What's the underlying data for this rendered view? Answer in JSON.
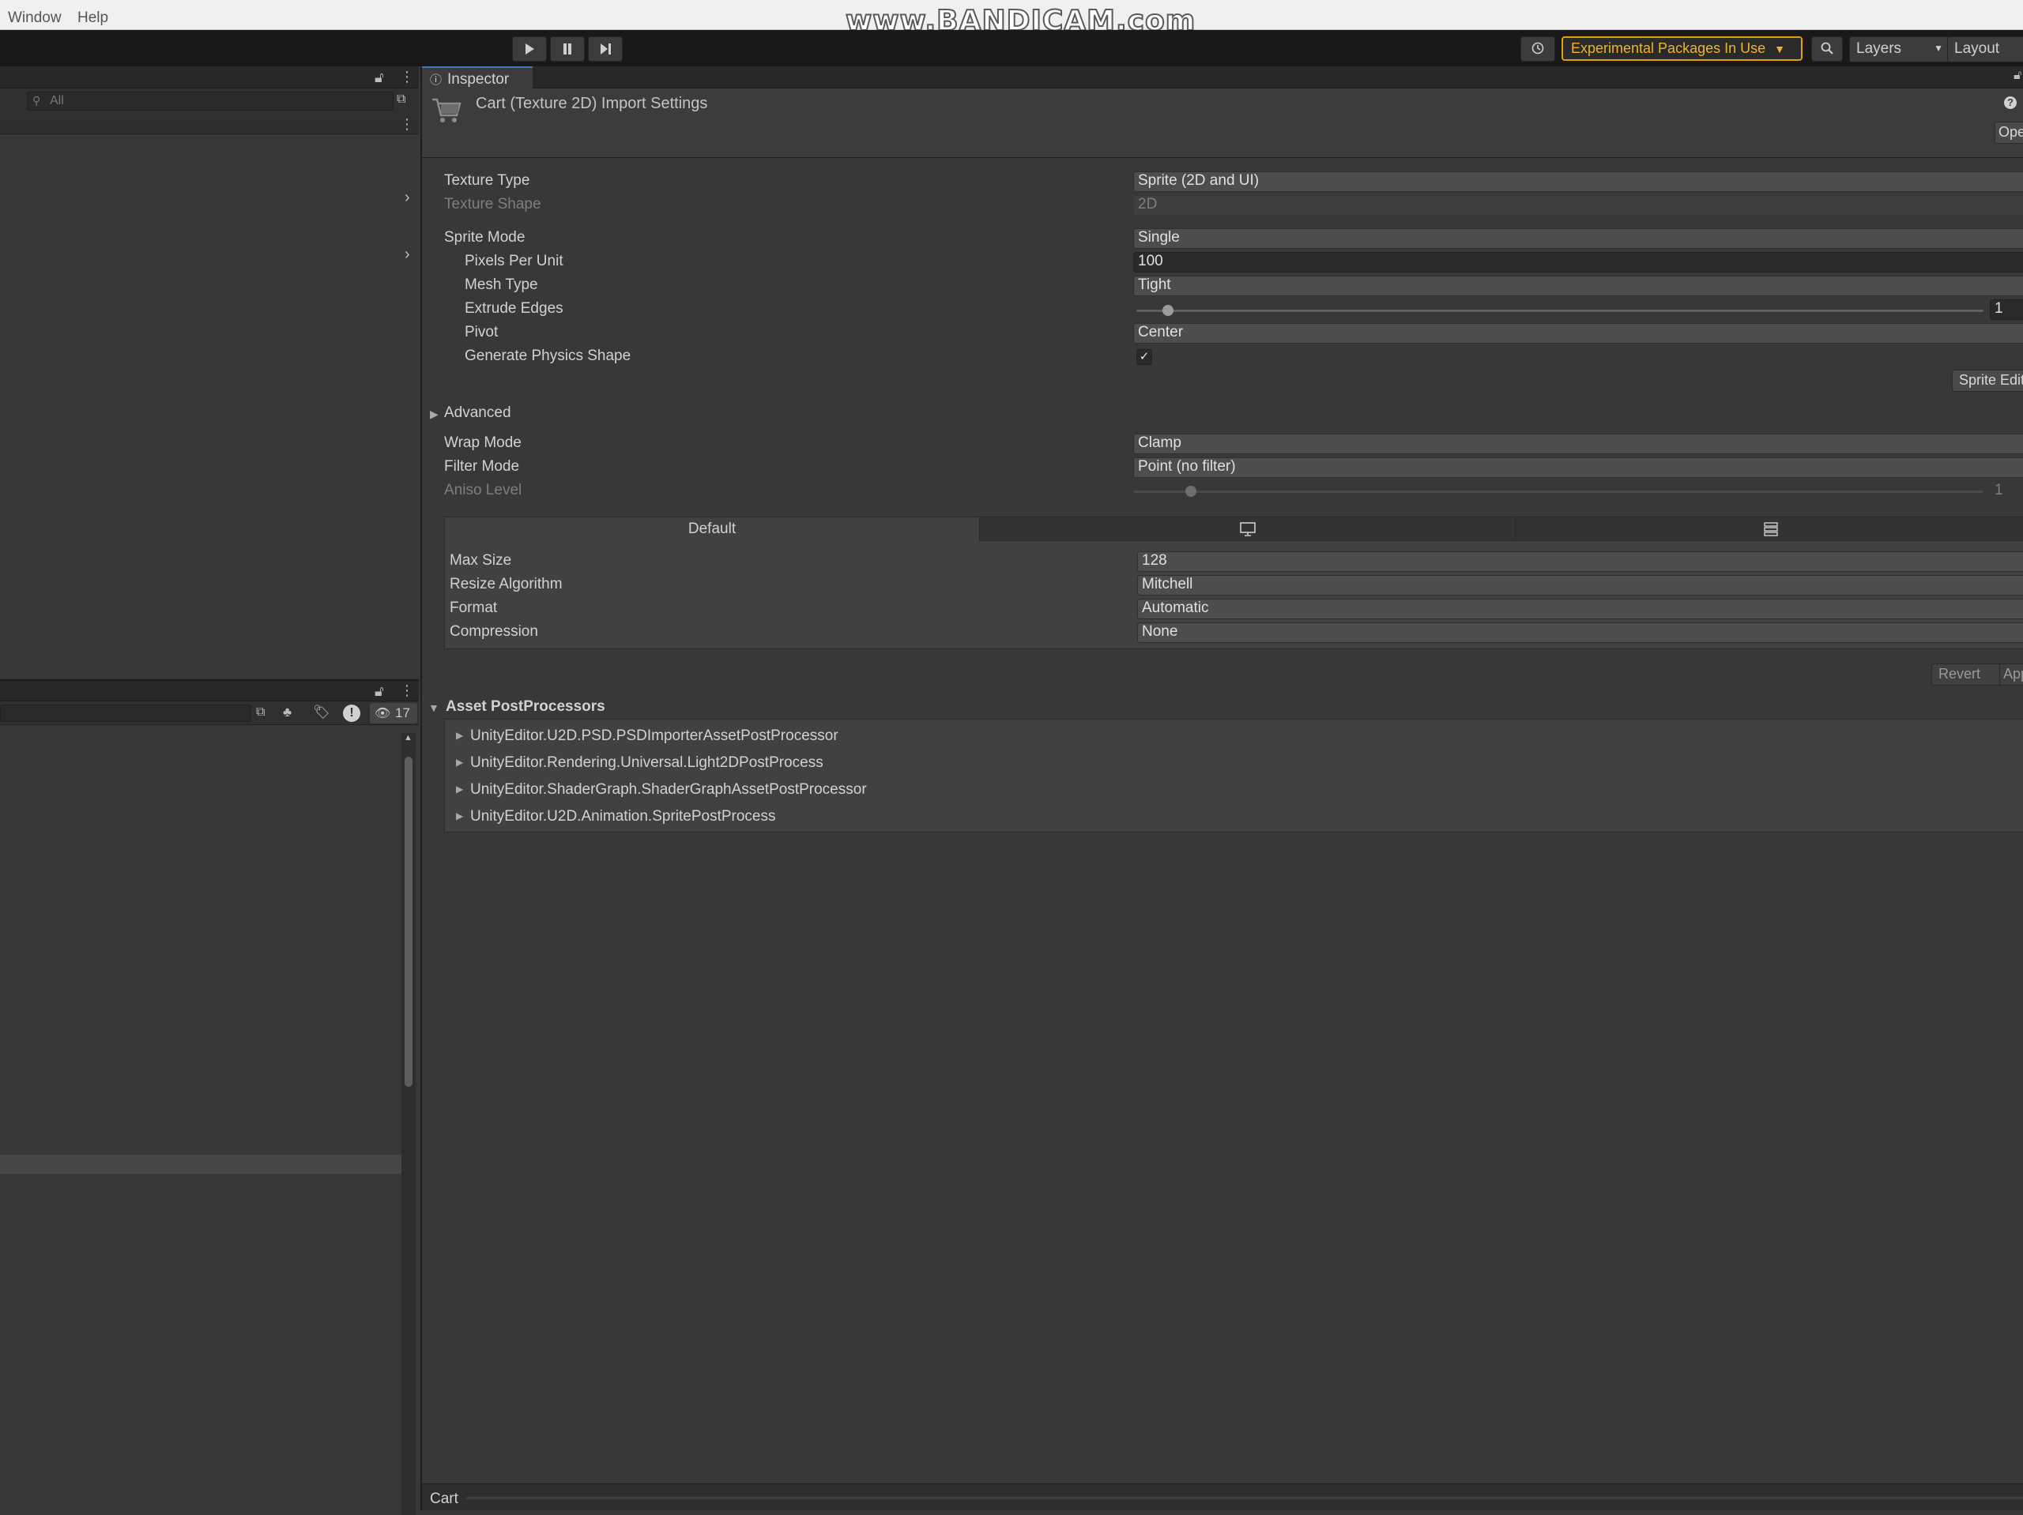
{
  "menu": {
    "items": [
      "Window",
      "Help"
    ]
  },
  "watermark": "www.BANDICAM.com",
  "toolbar": {
    "experimental_label": "Experimental Packages In Use",
    "layers_label": "Layers",
    "layout_label": "Layout"
  },
  "left_top_panel": {
    "search_placeholder": "All"
  },
  "left_bottom_panel": {
    "hidden_count": "17"
  },
  "inspector": {
    "tab_label": "Inspector",
    "asset_title": "Cart (Texture 2D) Import Settings",
    "open_button": "Open",
    "properties": {
      "texture_type": {
        "label": "Texture Type",
        "value": "Sprite (2D and UI)"
      },
      "texture_shape": {
        "label": "Texture Shape",
        "value": "2D"
      },
      "sprite_mode": {
        "label": "Sprite Mode",
        "value": "Single"
      },
      "pixels_per_unit": {
        "label": "Pixels Per Unit",
        "value": "100"
      },
      "mesh_type": {
        "label": "Mesh Type",
        "value": "Tight"
      },
      "extrude_edges": {
        "label": "Extrude Edges",
        "value": "1"
      },
      "pivot": {
        "label": "Pivot",
        "value": "Center"
      },
      "generate_physics_shape": {
        "label": "Generate Physics Shape",
        "checked": true
      },
      "sprite_editor_button": "Sprite Editor",
      "advanced": "Advanced",
      "wrap_mode": {
        "label": "Wrap Mode",
        "value": "Clamp"
      },
      "filter_mode": {
        "label": "Filter Mode",
        "value": "Point (no filter)"
      },
      "aniso_level": {
        "label": "Aniso Level",
        "value": "1"
      }
    },
    "platform_tabs": {
      "default_label": "Default",
      "tab2_icon": "monitor-icon",
      "tab3_icon": "grid-icon"
    },
    "platform_settings": {
      "max_size": {
        "label": "Max Size",
        "value": "128"
      },
      "resize_algorithm": {
        "label": "Resize Algorithm",
        "value": "Mitchell"
      },
      "format": {
        "label": "Format",
        "value": "Automatic"
      },
      "compression": {
        "label": "Compression",
        "value": "None"
      }
    },
    "revert_button": "Revert",
    "apply_button": "Apply",
    "postprocessors": {
      "title": "Asset PostProcessors",
      "items": [
        "UnityEditor.U2D.PSD.PSDImporterAssetPostProcessor",
        "UnityEditor.Rendering.Universal.Light2DPostProcess",
        "UnityEditor.ShaderGraph.ShaderGraphAssetPostProcessor",
        "UnityEditor.U2D.Animation.SpritePostProcess"
      ]
    },
    "preview_label": "Cart"
  },
  "colors": {
    "accent_warning": "#f0b429",
    "panel_bg": "#383838",
    "toolbar_bg": "#191919"
  }
}
